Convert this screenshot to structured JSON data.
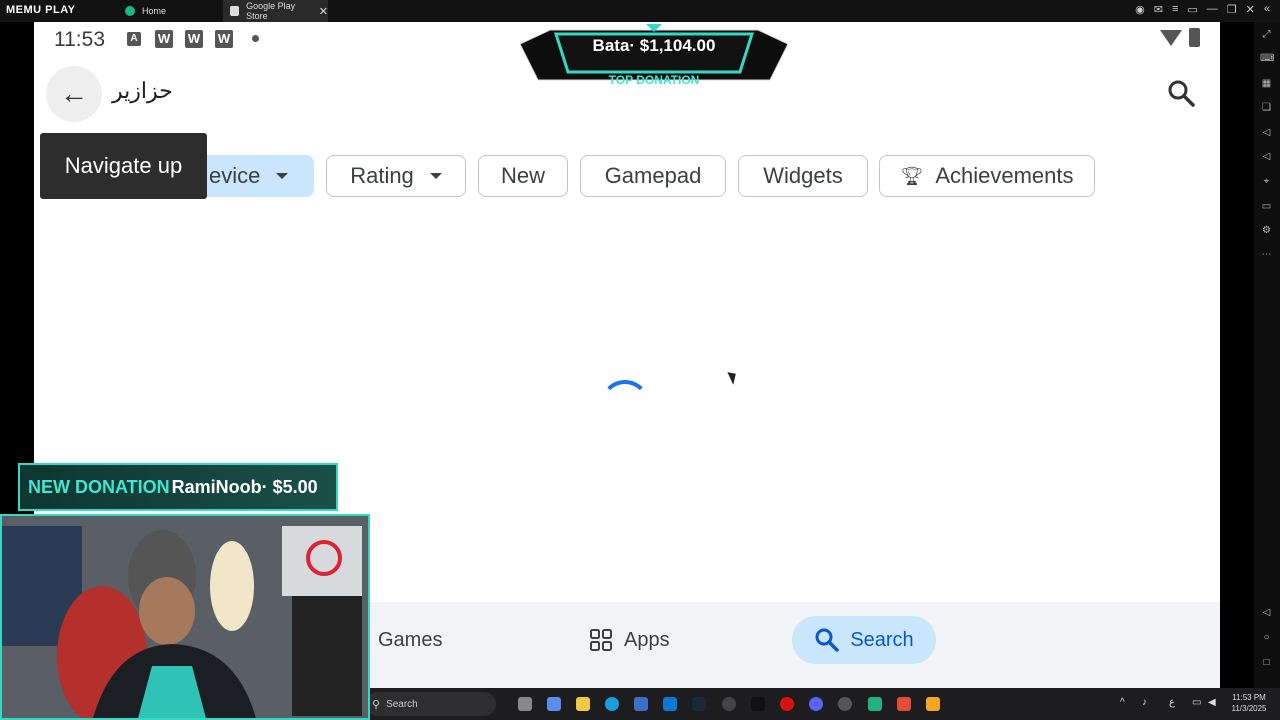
{
  "emulator": {
    "logo": "MEMU PLAY",
    "tabs": [
      {
        "label": "Home",
        "icon": "memu-home-icon"
      },
      {
        "label": "Google Play Store",
        "icon": "play-store-icon",
        "close": "✕"
      }
    ]
  },
  "status_bar": {
    "time": "11:53",
    "icons": [
      "A",
      "W",
      "W",
      "W"
    ]
  },
  "search_bar": {
    "query": "حزازير"
  },
  "tooltip": "Navigate up",
  "chips": [
    {
      "label": "evice",
      "dropdown": true
    },
    {
      "label": "Rating",
      "dropdown": true
    },
    {
      "label": "New"
    },
    {
      "label": "Gamepad"
    },
    {
      "label": "Widgets"
    },
    {
      "label": "Achievements",
      "icon": "trophy-icon"
    }
  ],
  "bottom_nav": {
    "games": "Games",
    "apps": "Apps",
    "search": "Search"
  },
  "overlay": {
    "top_donation_name": "Bata",
    "top_donation_amount": "$1,104.00",
    "top_donation_label": "TOP DONATION",
    "new_donation_label": "NEW DONATION",
    "new_donation_text": "RamiNoob· $5.00"
  },
  "taskbar": {
    "search_label": "Search",
    "time": "11:53 PM",
    "date": "11/3/2025",
    "lang": "ع"
  },
  "colors": {
    "accent": "#1a73e8",
    "chip_selected": "#c9e6fc",
    "overlay_teal": "#36d8c3"
  }
}
